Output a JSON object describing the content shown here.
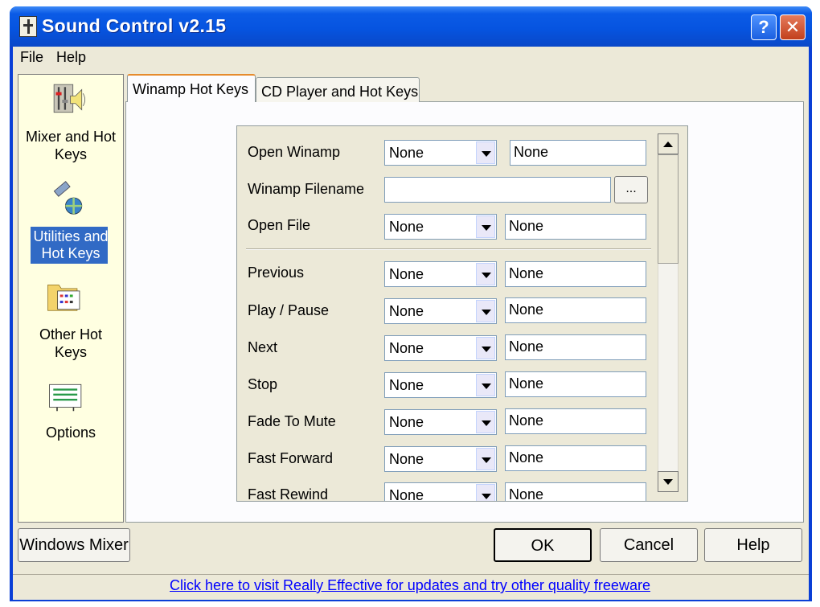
{
  "window": {
    "title": "Sound Control v2.15"
  },
  "titlebar_buttons": {
    "help": "?",
    "close": "✕"
  },
  "menu": [
    "File",
    "Help"
  ],
  "nav": {
    "items": [
      {
        "label": "Mixer and Hot Keys",
        "line1": "Mixer and Hot",
        "line2": "Keys",
        "icon": "mixer-speaker-icon"
      },
      {
        "label": "Utilities and Hot Keys",
        "line1": "Utilities and",
        "line2": "Hot Keys",
        "icon": "utilities-globe-icon",
        "selected": true
      },
      {
        "label": "Other Hot Keys",
        "line1": "Other Hot",
        "line2": "Keys",
        "icon": "folder-keys-icon"
      },
      {
        "label": "Options",
        "line1": "Options",
        "line2": "",
        "icon": "options-list-icon"
      }
    ]
  },
  "tabs": [
    {
      "label": "Winamp Hot Keys",
      "active": true
    },
    {
      "label": "CD Player and Hot Keys",
      "active": false
    }
  ],
  "form": {
    "open_winamp": {
      "label": "Open Winamp",
      "combo": "None",
      "hotkey": "None"
    },
    "winamp_filename": {
      "label": "Winamp Filename",
      "value": "",
      "browse": "..."
    },
    "open_file": {
      "label": "Open File",
      "combo": "None",
      "hotkey": "None"
    },
    "rows": [
      {
        "label": "Previous",
        "combo": "None",
        "hotkey": "None"
      },
      {
        "label": "Play / Pause",
        "combo": "None",
        "hotkey": "None"
      },
      {
        "label": "Next",
        "combo": "None",
        "hotkey": "None"
      },
      {
        "label": "Stop",
        "combo": "None",
        "hotkey": "None"
      },
      {
        "label": "Fade To Mute",
        "combo": "None",
        "hotkey": "None"
      },
      {
        "label": "Fast Forward",
        "combo": "None",
        "hotkey": "None"
      },
      {
        "label": "Fast Rewind",
        "combo": "None",
        "hotkey": "None"
      }
    ]
  },
  "buttons": {
    "windows_mixer": "Windows Mixer",
    "ok": "OK",
    "cancel": "Cancel",
    "help": "Help"
  },
  "footer": {
    "link": "Click here to visit Really Effective for updates and try other quality freeware"
  },
  "colors": {
    "title_blue": "#0654e0",
    "nav_bg": "#ffffe1",
    "selection": "#316ac5",
    "link": "#0000ff",
    "dialog": "#ece9d8"
  }
}
